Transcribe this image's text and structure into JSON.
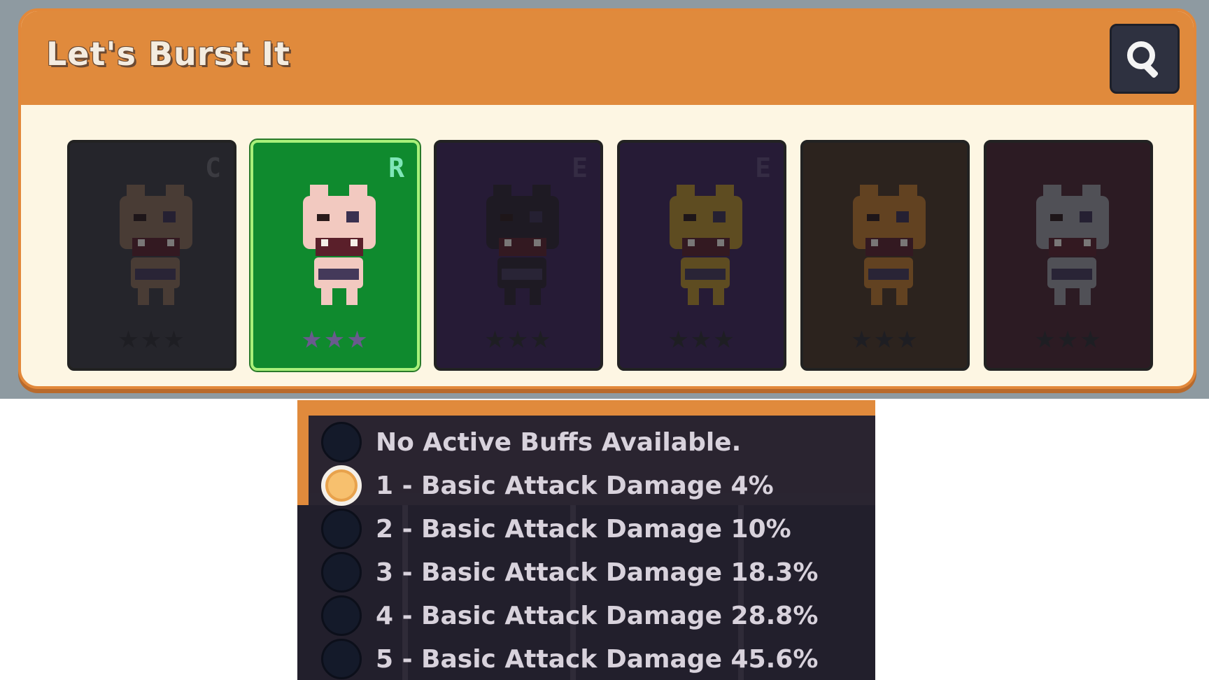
{
  "panel": {
    "title": "Let's Burst It"
  },
  "search_icon": "magnifier-icon",
  "cards": [
    {
      "rarity": "C",
      "stars": "★★★",
      "bg": "#3b3a40",
      "rarity_color": "#6c6a72",
      "char": "#8a6d58",
      "state": "dim"
    },
    {
      "rarity": "R",
      "stars": "★★★",
      "bg": "#0f8a2e",
      "rarity_color": "#7fe6b8",
      "char": "#f2c9c0",
      "state": "selected"
    },
    {
      "rarity": "E",
      "stars": "★★★",
      "bg": "#3c2559",
      "rarity_color": "#5e4a78",
      "char": "#2b2230",
      "state": "dim"
    },
    {
      "rarity": "E",
      "stars": "★★★",
      "bg": "#3c2559",
      "rarity_color": "#5e4a78",
      "char": "#b8902a",
      "state": "dim"
    },
    {
      "rarity": "",
      "stars": "★★★",
      "bg": "#4a3525",
      "rarity_color": "#6a5040",
      "char": "#c27a2c",
      "state": "dim"
    },
    {
      "rarity": "",
      "stars": "★★★",
      "bg": "#4a2530",
      "rarity_color": "#6a3a48",
      "char": "#9a9aa0",
      "state": "dim"
    }
  ],
  "buffs": [
    {
      "label": "No Active Buffs Available.",
      "active": false
    },
    {
      "label": "1 - Basic Attack Damage 4%",
      "active": true
    },
    {
      "label": "2 - Basic Attack Damage 10%",
      "active": false
    },
    {
      "label": "3 - Basic Attack Damage 18.3%",
      "active": false
    },
    {
      "label": "4 - Basic Attack Damage 28.8%",
      "active": false
    },
    {
      "label": "5 - Basic Attack Damage 45.6%",
      "active": false
    }
  ]
}
